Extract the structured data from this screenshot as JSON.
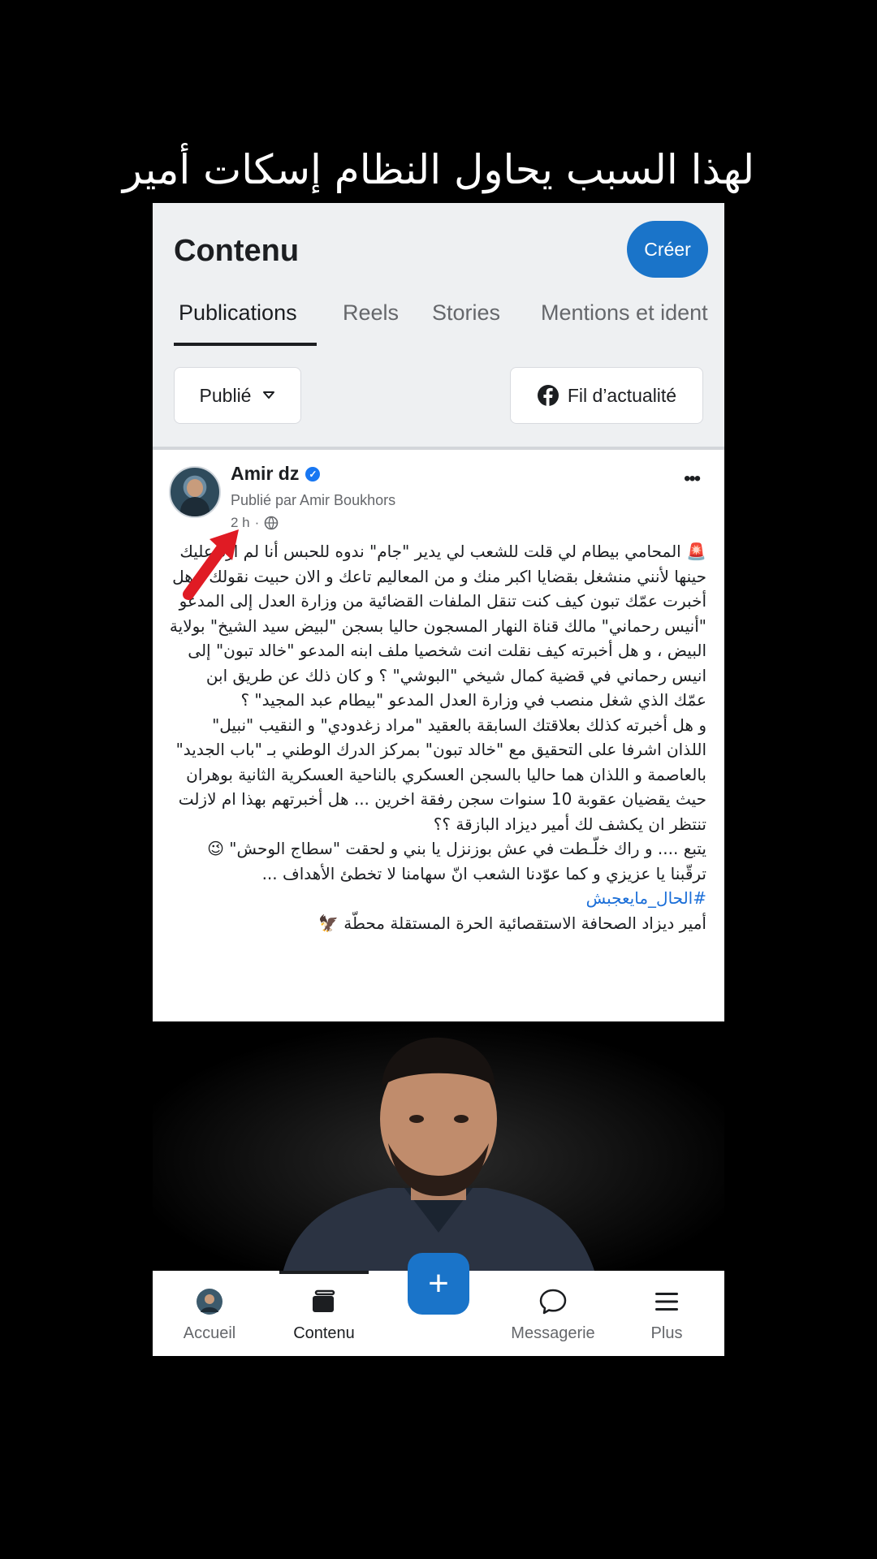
{
  "overlay": {
    "caption": "لهذا السبب يحاول النظام إسكات أمير"
  },
  "header": {
    "title": "Contenu",
    "create_label": "Créer",
    "tabs": [
      {
        "label": "Publications",
        "active": true
      },
      {
        "label": "Reels",
        "active": false
      },
      {
        "label": "Stories",
        "active": false
      },
      {
        "label": "Mentions et ident",
        "active": false
      }
    ],
    "filter": {
      "selected": "Publié"
    },
    "feed_button": "Fil d’actualité"
  },
  "post": {
    "author": "Amir dz",
    "verified": true,
    "posted_by": "Publié par Amir Boukhors",
    "time": "2 h",
    "audience_icon": "globe-icon",
    "paragraphs": [
      "🚨 المحامي بيطام لي قلت للشعب لي يدير \"جام\" ندوه للحبس أنا لم ارد عليك حينها لأنني منشغل بقضايا اكبر منك و من المعاليم تاعك و الان حبيت نقولك : هل أخبرت عمّك تبون كيف كنت تنقل الملفات القضائية من وزارة العدل إلى المدعو \"أنيس رحماني\" مالك قناة النهار المسجون حاليا بسجن \"لبيض سيد الشيخ\" بولاية البيض ، و هل أخبرته كيف نقلت انت شخصيا ملف ابنه المدعو \"خالد تبون\" إلى انيس رحماني في قضية كمال شيخي \"البوشي\" ؟ و كان ذلك عن طريق ابن عمّك الذي شغل منصب في وزارة العدل المدعو \"بيطام عبد المجيد\" ؟",
      "و هل أخبرته كذلك بعلاقتك السابقة بالعقيد \"مراد زغدودي\" و النقيب \"نبيل\" اللذان اشرفا على التحقيق مع \"خالد تبون\" بمركز الدرك الوطني بـ \"باب الجديد\" بالعاصمة و اللذان هما حاليا بالسجن العسكري بالناحية العسكرية الثانية بوهران حيث يقضيان عقوبة 10 سنوات سجن رفقة اخرين ... هل أخبرتهم بهذا ام لازلت تنتظر ان يكشف لك أمير ديزاد البازقة ؟؟",
      "يتبع .... و راك خلّـطت في عش بوزنزل يا بني و لحقت \"سطاج الوحش\" 😉 ترقّبنا يا عزيزي و كما عوّدنا الشعب انّ سهامنا لا تخطئ الأهداف ..."
    ],
    "hashtag": "#الحال_مايعجبش",
    "signature": "أمير ديزاد الصحافة الاستقصائية الحرة المستقلة محطّة 🦅"
  },
  "bottom_nav": [
    {
      "label": "Accueil",
      "icon": "profile-avatar-icon"
    },
    {
      "label": "Contenu",
      "icon": "content-icon",
      "active": true
    },
    {
      "label": "",
      "icon": "plus-icon"
    },
    {
      "label": "Messagerie",
      "icon": "chat-bubble-icon"
    },
    {
      "label": "Plus",
      "icon": "menu-icon"
    }
  ],
  "colors": {
    "accent": "#1a74c9",
    "arrow": "#e01b24",
    "background": "#000000"
  }
}
